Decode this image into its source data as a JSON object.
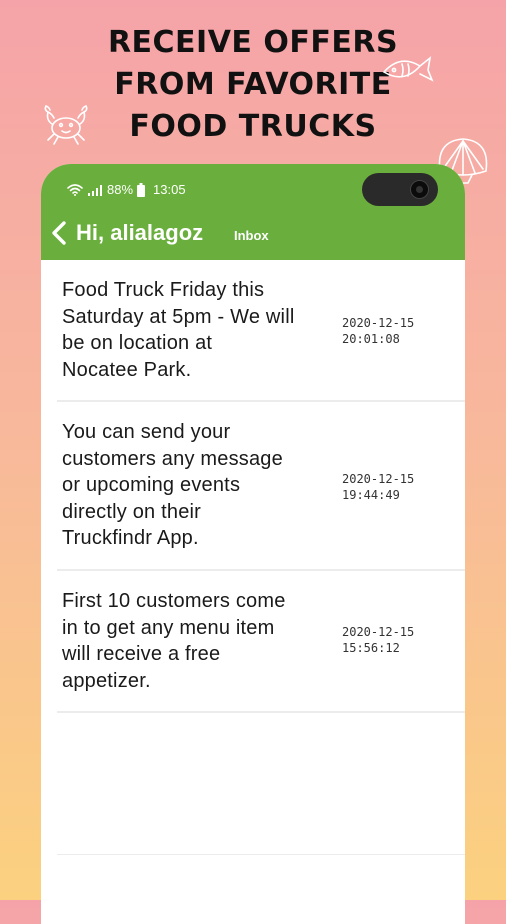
{
  "promo": {
    "headline_lines": [
      "RECEIVE OFFERS",
      "FROM FAVORITE",
      "FOOD TRUCKS"
    ]
  },
  "status_bar": {
    "battery": "88%",
    "time": "13:05"
  },
  "header": {
    "greeting": "Hi, alialagoz",
    "tab_label": "Inbox"
  },
  "messages": [
    {
      "text_lines": [
        "Food Truck Friday this",
        "Saturday at 5pm - We will",
        "be on location at",
        "Nocatee Park."
      ],
      "date": "2020-12-15",
      "time": "20:01:08"
    },
    {
      "text_lines": [
        "You can send your",
        "customers any message",
        "or upcoming events",
        "directly on their",
        "Truckfindr App."
      ],
      "date": "2020-12-15",
      "time": "19:44:49"
    },
    {
      "text_lines": [
        "First 10 customers come",
        "in to get any menu item",
        "will receive a free",
        "appetizer."
      ],
      "date": "2020-12-15",
      "time": "15:56:12"
    }
  ],
  "colors": {
    "header_green": "#6aaf3d",
    "bg_top": "#f5a3a8",
    "bg_bottom": "#fbd17f"
  }
}
